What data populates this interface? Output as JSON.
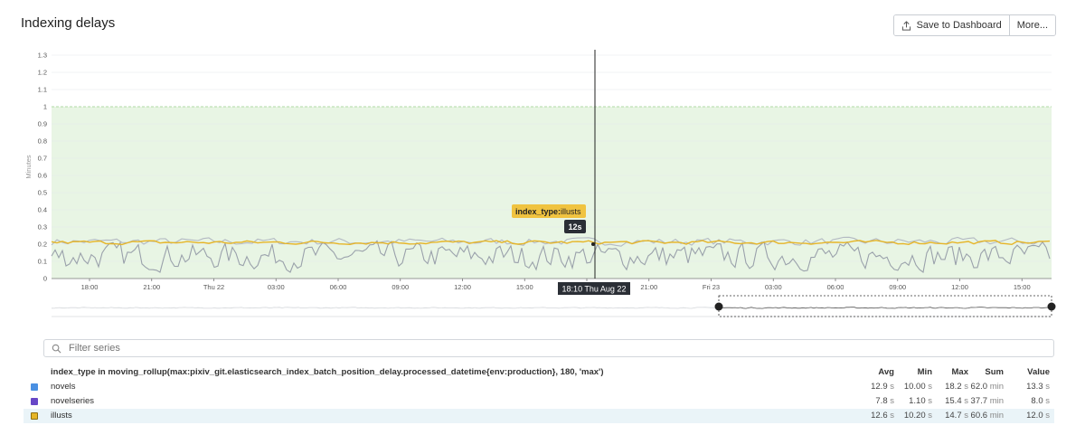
{
  "header": {
    "title": "Indexing delays",
    "save_label": "Save to Dashboard",
    "more_label": "More..."
  },
  "chart_data": {
    "type": "line",
    "ylabel": "Minutes",
    "ylim": [
      0,
      1.3
    ],
    "yticks": [
      "0",
      "0.1",
      "0.2",
      "0.3",
      "0.4",
      "0.5",
      "0.6",
      "0.7",
      "0.8",
      "0.9",
      "1",
      "1.1",
      "1.2",
      "1.3"
    ],
    "xticks": [
      "18:00",
      "21:00",
      "Thu 22",
      "03:00",
      "06:00",
      "09:00",
      "12:00",
      "15:00",
      "18:00",
      "21:00",
      "Fri 23",
      "03:00",
      "06:00",
      "09:00",
      "12:00",
      "15:00"
    ],
    "threshold": 1,
    "threshold_band_color": "#e8f5e4",
    "cursor_label": "18:10 Thu Aug 22",
    "tooltip": {
      "key": "index_type",
      "value": "illusts",
      "reading": "12s"
    },
    "series": [
      {
        "name": "novels",
        "color": "#b3b9c2",
        "approx_level": 0.215,
        "spread": 0.02
      },
      {
        "name": "novelseries",
        "color": "#9aa1ab",
        "approx_level": 0.13,
        "spread": 0.07
      },
      {
        "name": "illusts",
        "color": "#e6b527",
        "approx_level": 0.21,
        "spread": 0.01
      }
    ]
  },
  "filter": {
    "placeholder": "Filter series"
  },
  "legend": {
    "query": "index_type in moving_rollup(max:pixiv_git.elasticsearch_index_batch_position_delay.processed_datetime{env:production}, 180, 'max')",
    "columns": [
      "Avg",
      "Min",
      "Max",
      "Sum",
      "Value"
    ],
    "rows": [
      {
        "name": "novels",
        "color": "#4a90e2",
        "avg": "12.9",
        "avg_u": "s",
        "min": "10.00",
        "min_u": "s",
        "max": "18.2",
        "max_u": "s",
        "sum": "62.0",
        "sum_u": "min",
        "value": "13.3",
        "value_u": "s"
      },
      {
        "name": "novelseries",
        "color": "#6747c7",
        "avg": "7.8",
        "avg_u": "s",
        "min": "1.10",
        "min_u": "s",
        "max": "15.4",
        "max_u": "s",
        "sum": "37.7",
        "sum_u": "min",
        "value": "8.0",
        "value_u": "s"
      },
      {
        "name": "illusts",
        "color": "#e6b527",
        "avg": "12.6",
        "avg_u": "s",
        "min": "10.20",
        "min_u": "s",
        "max": "14.7",
        "max_u": "s",
        "sum": "60.6",
        "sum_u": "min",
        "value": "12.0",
        "value_u": "s"
      }
    ]
  }
}
